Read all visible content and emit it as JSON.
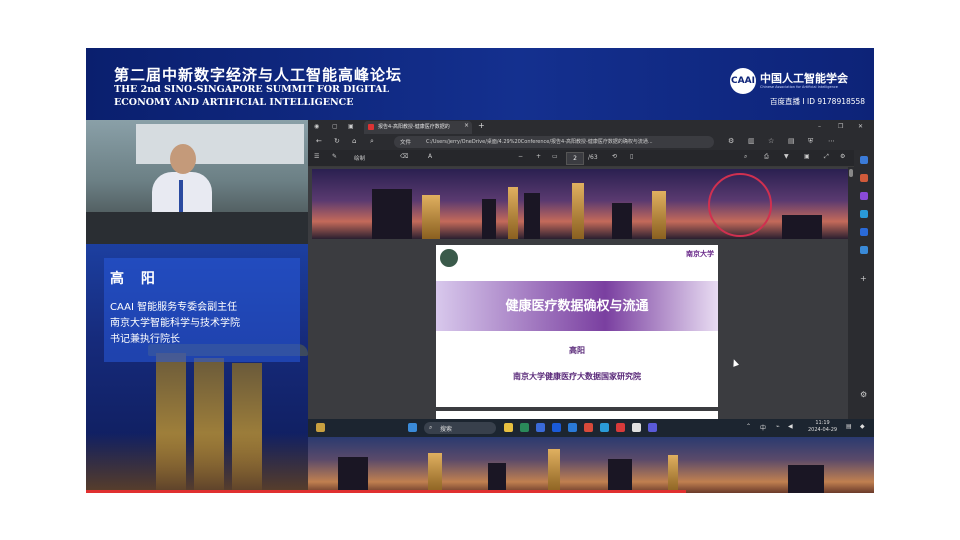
{
  "header": {
    "title_cn": "第二届中新数字经济与人工智能高峰论坛",
    "title_en_line1": "THE 2nd SINO-SINGAPORE SUMMIT FOR DIGITAL",
    "title_en_line2": "ECONOMY AND ARTIFICIAL INTELLIGENCE",
    "org_logo_text": "CAAI",
    "org_name_cn": "中国人工智能学会",
    "org_name_en": "Chinese Association for Artificial Intelligence",
    "live_id": "百度直播 I ID 9178918558"
  },
  "speaker": {
    "name": "高 阳",
    "line1": "CAAI 智能服务专委会副主任",
    "line2": "南京大学智能科学与技术学院",
    "line3": "书记兼执行院长"
  },
  "browser": {
    "tab_title": "报告4-高阳教授-健康医疗数据的",
    "url_label": "文件",
    "url": "C:/Users/jerry/OneDrive/桌面/4.29%20Conference/报告4-高阳教授-健康医疗数据的确权与流通...",
    "draw_label": "绘制",
    "current_page": "2",
    "total_pages": "/63"
  },
  "slide": {
    "title": "健康医疗数据确权与流通",
    "author": "高阳",
    "institute": "南京大学健康医疗大数据国家研究院",
    "logo_right": "南京大学"
  },
  "taskbar": {
    "search_label": "搜索",
    "ime": "中",
    "time": "11:19",
    "date": "2024-04-29"
  },
  "icons": {
    "accent": "#d03050",
    "brand_blue": "#14308f"
  }
}
